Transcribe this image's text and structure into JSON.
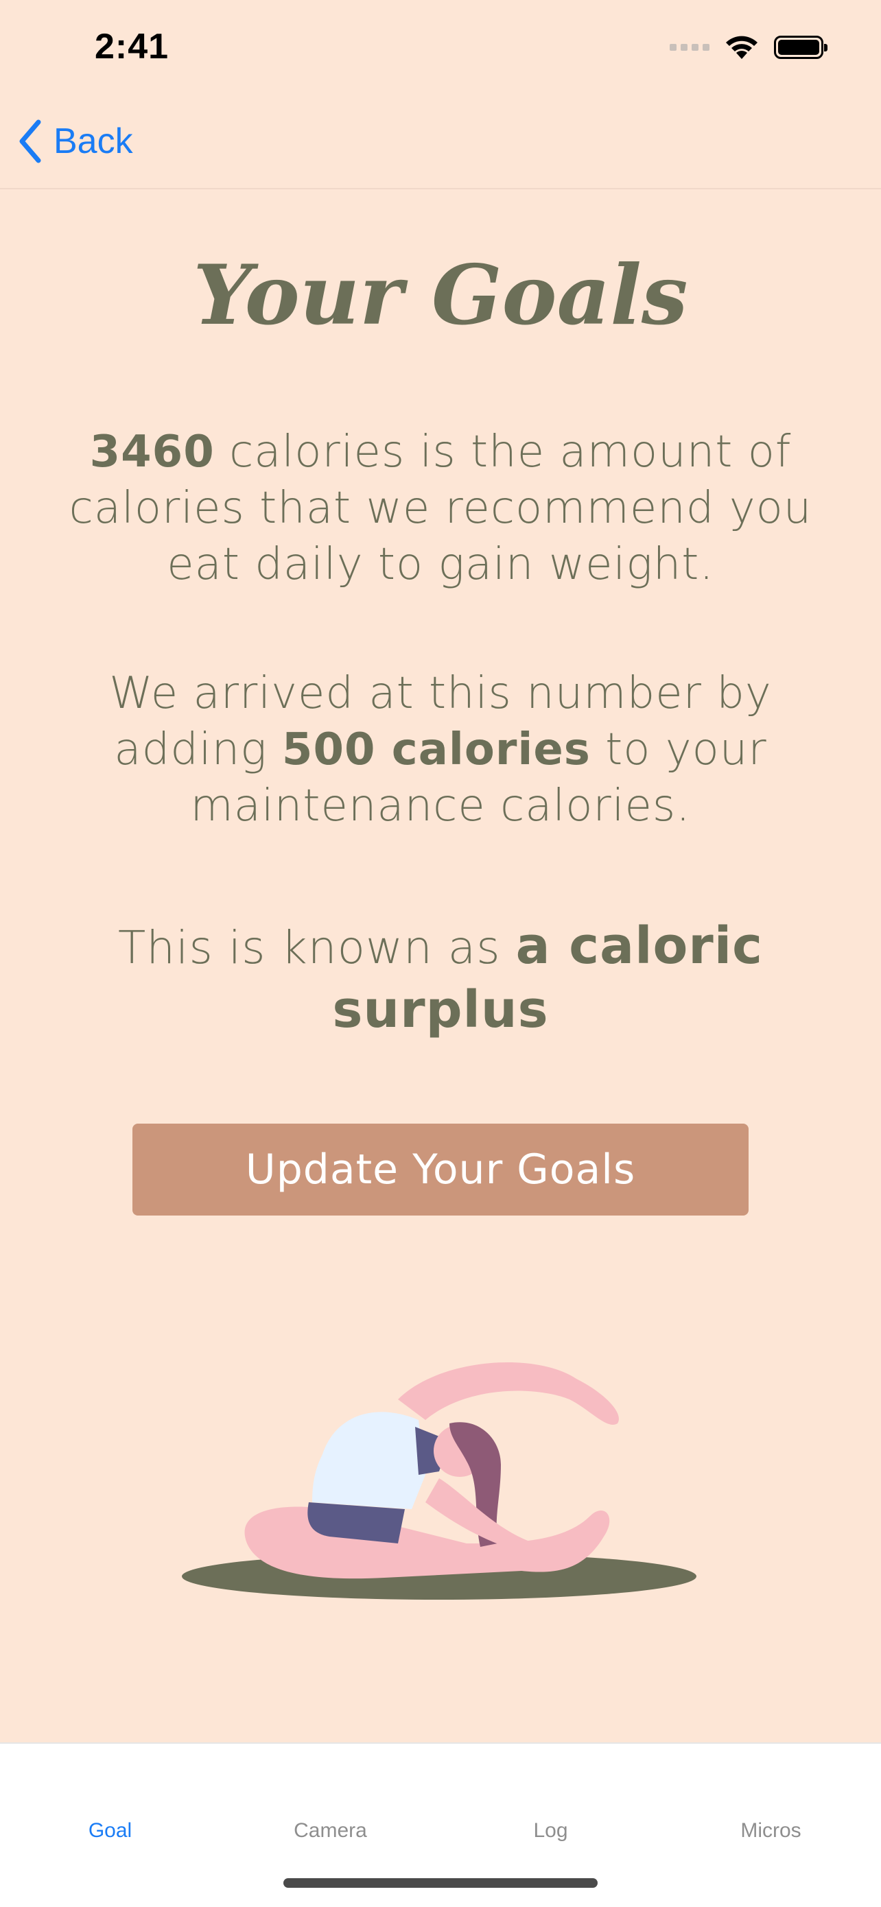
{
  "status_bar": {
    "time": "2:41"
  },
  "nav": {
    "back_label": "Back"
  },
  "main": {
    "title": "Your Goals",
    "p1_number": "3460",
    "p1_text": " calories is the amount of calories that we recommend you eat daily to gain weight.",
    "p2_text_a": "We arrived at this number by adding ",
    "p2_bold": "500 calories",
    "p2_text_b": " to your maintenance calories.",
    "p3_text_a": "This is known as ",
    "p3_bold": "a caloric surplus",
    "update_button_label": "Update Your Goals"
  },
  "tabs": [
    {
      "label": "Goal",
      "active": true
    },
    {
      "label": "Camera",
      "active": false
    },
    {
      "label": "Log",
      "active": false
    },
    {
      "label": "Micros",
      "active": false
    }
  ],
  "colors": {
    "background": "#fde6d6",
    "text": "#6c6f58",
    "button": "#cb967b",
    "accent": "#1a7cf5"
  },
  "icons": {
    "back": "chevron-left-icon",
    "wifi": "wifi-icon",
    "battery": "battery-icon",
    "signal": "cellular-signal-icon"
  }
}
